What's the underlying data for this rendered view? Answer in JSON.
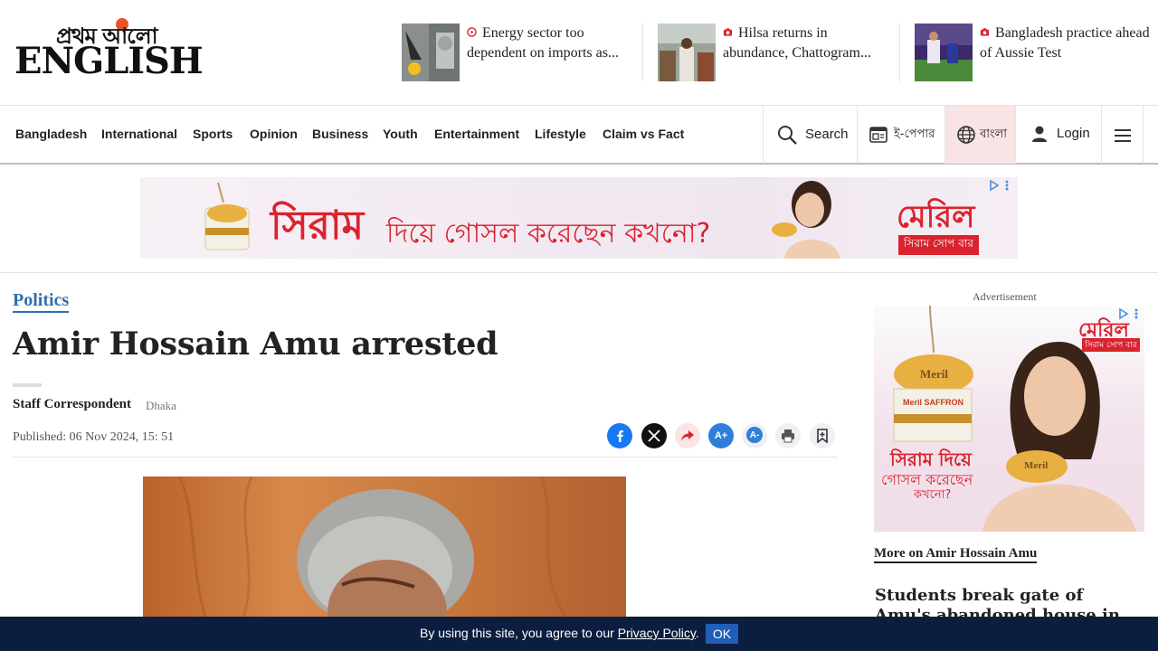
{
  "header": {
    "logo_bn": "প্রথম আলো",
    "logo_en": "ENGLISH",
    "teasers": [
      {
        "text": "Energy sector too dependent on imports as..."
      },
      {
        "text": "Hilsa returns in abundance, Chattogram..."
      },
      {
        "text": "Bangladesh practice ahead of Aussie Test"
      }
    ]
  },
  "nav": {
    "items": [
      "Bangladesh",
      "International",
      "Sports",
      "Opinion",
      "Business",
      "Youth",
      "Entertainment",
      "Lifestyle",
      "Claim vs Fact"
    ],
    "search_label": "Search",
    "epaper_label": "ই-পেপার",
    "bangla_label": "বাংলা",
    "login_label": "Login"
  },
  "banner_ad": {
    "text_main": "সিরাম",
    "text_rest": "দিয়ে গোসল করেছেন কখনো?",
    "brand": "মেরিল",
    "brand_sub": "সিরাম সোপ বার"
  },
  "article": {
    "category": "Politics",
    "title": "Amir Hossain Amu arrested",
    "author": "Staff Correspondent",
    "location": "Dhaka",
    "published": "Published: 06 Nov 2024, 15: 51",
    "share": {
      "font_plus": "A+",
      "font_minus": "A-"
    }
  },
  "sidebar": {
    "ad_label": "Advertisement",
    "ad_brand": "মেরিল",
    "ad_brand_sub": "সিরাম সোপ বার",
    "ad_text_1": "সিরাম দিয়ে",
    "ad_text_2": "গোসল করেছেন",
    "ad_text_3": "কখনো?",
    "ad_soap": "Meril",
    "ad_pack": "Meril SAFFRON",
    "more_title": "More on Amir Hossain Amu",
    "story": "Students break gate of Amu's abandoned house in Jhalakathi"
  },
  "cookie": {
    "text": "By using this site, you agree to our ",
    "policy": "Privacy Policy",
    "dot": ".",
    "ok": "OK"
  },
  "colors": {
    "accent": "#2f6fae",
    "cookie_bg": "#0c1e3f",
    "ok_bg": "#1f5fb8",
    "ad_red": "#d9232e"
  }
}
